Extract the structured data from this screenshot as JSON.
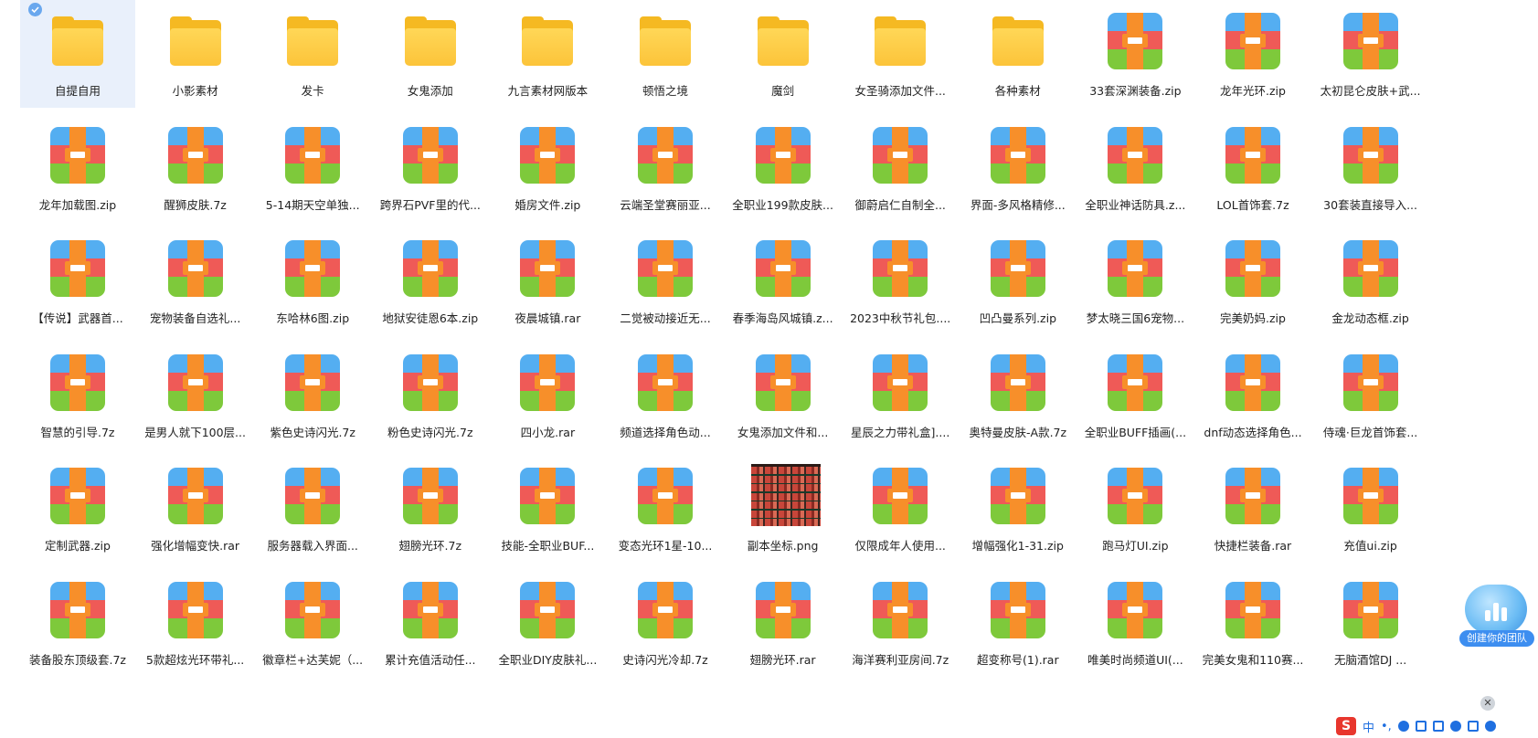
{
  "items": [
    {
      "label": "自提自用",
      "type": "folder",
      "selected": true
    },
    {
      "label": "小影素材",
      "type": "folder"
    },
    {
      "label": "发卡",
      "type": "folder"
    },
    {
      "label": "女鬼添加",
      "type": "folder"
    },
    {
      "label": "九言素材网版本",
      "type": "folder"
    },
    {
      "label": "顿悟之境",
      "type": "folder"
    },
    {
      "label": "魔剑",
      "type": "folder"
    },
    {
      "label": "女圣骑添加文件...",
      "type": "folder"
    },
    {
      "label": "各种素材",
      "type": "folder"
    },
    {
      "label": "33套深渊装备.zip",
      "type": "archive"
    },
    {
      "label": "龙年光环.zip",
      "type": "archive"
    },
    {
      "label": "太初昆仑皮肤+武...",
      "type": "archive"
    },
    {
      "label": "龙年加载图.zip",
      "type": "archive"
    },
    {
      "label": "醒狮皮肤.7z",
      "type": "archive"
    },
    {
      "label": "5-14期天空单独...",
      "type": "archive"
    },
    {
      "label": "跨界石PVF里的代...",
      "type": "archive"
    },
    {
      "label": "婚房文件.zip",
      "type": "archive"
    },
    {
      "label": "云端圣堂赛丽亚...",
      "type": "archive"
    },
    {
      "label": "全职业199款皮肤...",
      "type": "archive"
    },
    {
      "label": "御蔚启仁自制全...",
      "type": "archive"
    },
    {
      "label": "界面-多风格精修...",
      "type": "archive"
    },
    {
      "label": "全职业神话防具.z...",
      "type": "archive"
    },
    {
      "label": "LOL首饰套.7z",
      "type": "archive"
    },
    {
      "label": "30套装直接导入...",
      "type": "archive"
    },
    {
      "label": "【传说】武器首...",
      "type": "archive"
    },
    {
      "label": "宠物装备自选礼...",
      "type": "archive"
    },
    {
      "label": "东哈林6图.zip",
      "type": "archive"
    },
    {
      "label": "地狱安徒恩6本.zip",
      "type": "archive"
    },
    {
      "label": "夜晨城镇.rar",
      "type": "archive"
    },
    {
      "label": "二觉被动接近无...",
      "type": "archive"
    },
    {
      "label": "春季海岛风城镇.z...",
      "type": "archive"
    },
    {
      "label": "2023中秋节礼包....",
      "type": "archive"
    },
    {
      "label": "凹凸曼系列.zip",
      "type": "archive"
    },
    {
      "label": "梦太晓三国6宠物...",
      "type": "archive"
    },
    {
      "label": "完美奶妈.zip",
      "type": "archive"
    },
    {
      "label": "金龙动态框.zip",
      "type": "archive"
    },
    {
      "label": "智慧的引导.7z",
      "type": "archive"
    },
    {
      "label": "是男人就下100层...",
      "type": "archive"
    },
    {
      "label": "紫色史诗闪光.7z",
      "type": "archive"
    },
    {
      "label": "粉色史诗闪光.7z",
      "type": "archive"
    },
    {
      "label": "四小龙.rar",
      "type": "archive"
    },
    {
      "label": "频道选择角色动...",
      "type": "archive"
    },
    {
      "label": "女鬼添加文件和...",
      "type": "archive"
    },
    {
      "label": "星辰之力带礼盒]....",
      "type": "archive"
    },
    {
      "label": "奥特曼皮肤-A款.7z",
      "type": "archive"
    },
    {
      "label": "全职业BUFF插画(...",
      "type": "archive"
    },
    {
      "label": "dnf动态选择角色...",
      "type": "archive"
    },
    {
      "label": "侍魂·巨龙首饰套...",
      "type": "archive"
    },
    {
      "label": "定制武器.zip",
      "type": "archive"
    },
    {
      "label": "强化增幅变快.rar",
      "type": "archive"
    },
    {
      "label": "服务器载入界面...",
      "type": "archive"
    },
    {
      "label": "翅膀光环.7z",
      "type": "archive"
    },
    {
      "label": "技能-全职业BUF...",
      "type": "archive"
    },
    {
      "label": "变态光环1星-10...",
      "type": "archive"
    },
    {
      "label": "副本坐标.png",
      "type": "image"
    },
    {
      "label": "仅限成年人使用...",
      "type": "archive"
    },
    {
      "label": "增幅强化1-31.zip",
      "type": "archive"
    },
    {
      "label": "跑马灯UI.zip",
      "type": "archive"
    },
    {
      "label": "快捷栏装备.rar",
      "type": "archive"
    },
    {
      "label": "充值ui.zip",
      "type": "archive"
    },
    {
      "label": "装备股东顶级套.7z",
      "type": "archive"
    },
    {
      "label": "5款超炫光环带礼...",
      "type": "archive"
    },
    {
      "label": "徽章栏+达芙妮（...",
      "type": "archive"
    },
    {
      "label": "累计充值活动任...",
      "type": "archive"
    },
    {
      "label": "全职业DIY皮肤礼...",
      "type": "archive"
    },
    {
      "label": "史诗闪光冷却.7z",
      "type": "archive"
    },
    {
      "label": "翅膀光环.rar",
      "type": "archive"
    },
    {
      "label": "海洋赛利亚房间.7z",
      "type": "archive"
    },
    {
      "label": "超变称号(1).rar",
      "type": "archive"
    },
    {
      "label": "唯美时尚频道UI(...",
      "type": "archive"
    },
    {
      "label": "完美女鬼和110赛...",
      "type": "archive"
    },
    {
      "label": "无脑酒馆DJ ...",
      "type": "archive"
    }
  ],
  "widget": {
    "caption": "创建你的团队",
    "close": "✕"
  },
  "ime": {
    "logo": "S",
    "lang": "中",
    "punct": "•,"
  },
  "colors": {
    "selected_bg": "#e9f0fb",
    "folder": "#fcc43a",
    "archive_blue": "#54aef1",
    "archive_red": "#ef5a57",
    "archive_green": "#7ec93b",
    "strap": "#f78f2a"
  }
}
